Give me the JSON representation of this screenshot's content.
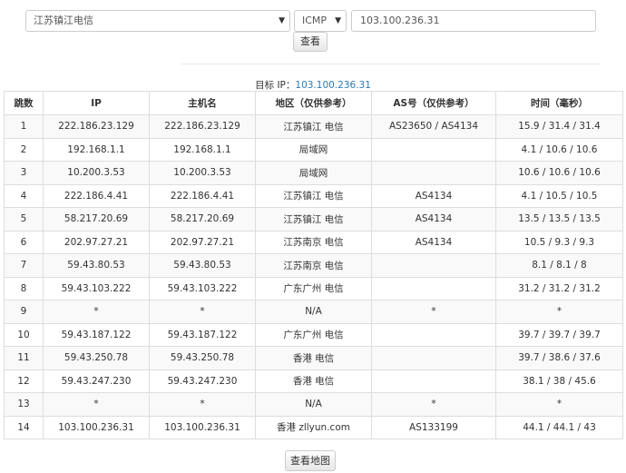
{
  "form": {
    "location_select": "江苏镇江电信",
    "protocol_select": "ICMP",
    "target_input": "103.100.236.31",
    "submit_label": "查看"
  },
  "target_line": {
    "label": "目标 IP：",
    "ip": "103.100.236.31"
  },
  "table": {
    "headers": [
      "跳数",
      "IP",
      "主机名",
      "地区（仅供参考）",
      "AS号（仅供参考）",
      "时间（毫秒）"
    ],
    "rows": [
      {
        "hop": "1",
        "ip": "222.186.23.129",
        "ip_link": true,
        "host": "222.186.23.129",
        "region": "江苏镇江 电信",
        "as": [
          "AS23650",
          "AS4134"
        ],
        "time": "15.9 / 31.4 / 31.4"
      },
      {
        "hop": "2",
        "ip": "192.168.1.1",
        "ip_link": true,
        "host": "192.168.1.1",
        "region": "局域网",
        "as": [],
        "time": "4.1 / 10.6 / 10.6"
      },
      {
        "hop": "3",
        "ip": "10.200.3.53",
        "ip_link": true,
        "host": "10.200.3.53",
        "region": "局域网",
        "as": [],
        "time": "10.6 / 10.6 / 10.6"
      },
      {
        "hop": "4",
        "ip": "222.186.4.41",
        "ip_link": true,
        "host": "222.186.4.41",
        "region": "江苏镇江 电信",
        "as": [
          "AS4134"
        ],
        "time": "4.1 / 10.5 / 10.5"
      },
      {
        "hop": "5",
        "ip": "58.217.20.69",
        "ip_link": true,
        "host": "58.217.20.69",
        "region": "江苏镇江 电信",
        "as": [
          "AS4134"
        ],
        "time": "13.5 / 13.5 / 13.5"
      },
      {
        "hop": "6",
        "ip": "202.97.27.21",
        "ip_link": true,
        "host": "202.97.27.21",
        "region": "江苏南京 电信",
        "as": [
          "AS4134"
        ],
        "time": "10.5 / 9.3 / 9.3"
      },
      {
        "hop": "7",
        "ip": "59.43.80.53",
        "ip_link": true,
        "host": "59.43.80.53",
        "region": "江苏南京 电信",
        "as": [],
        "time": "8.1 / 8.1 / 8"
      },
      {
        "hop": "8",
        "ip": "59.43.103.222",
        "ip_link": true,
        "host": "59.43.103.222",
        "region": "广东广州 电信",
        "as": [],
        "time": "31.2 / 31.2 / 31.2"
      },
      {
        "hop": "9",
        "ip": "*",
        "ip_link": false,
        "host": "*",
        "region": "N/A",
        "as_text": "*",
        "as": [],
        "time": "*"
      },
      {
        "hop": "10",
        "ip": "59.43.187.122",
        "ip_link": true,
        "host": "59.43.187.122",
        "region": "广东广州 电信",
        "as": [],
        "time": "39.7 / 39.7 / 39.7"
      },
      {
        "hop": "11",
        "ip": "59.43.250.78",
        "ip_link": true,
        "host": "59.43.250.78",
        "region": "香港 电信",
        "as": [],
        "time": "39.7 / 38.6 / 37.6"
      },
      {
        "hop": "12",
        "ip": "59.43.247.230",
        "ip_link": true,
        "host": "59.43.247.230",
        "region": "香港 电信",
        "as": [],
        "time": "38.1 / 38 / 45.6"
      },
      {
        "hop": "13",
        "ip": "*",
        "ip_link": false,
        "host": "*",
        "region": "N/A",
        "as_text": "*",
        "as": [],
        "time": "*"
      },
      {
        "hop": "14",
        "ip": "103.100.236.31",
        "ip_link": true,
        "host": "103.100.236.31",
        "region": "香港 zllyun.com",
        "as": [
          "AS133199"
        ],
        "time": "44.1 / 44.1 / 43"
      }
    ]
  },
  "map_button_label": "查看地图"
}
